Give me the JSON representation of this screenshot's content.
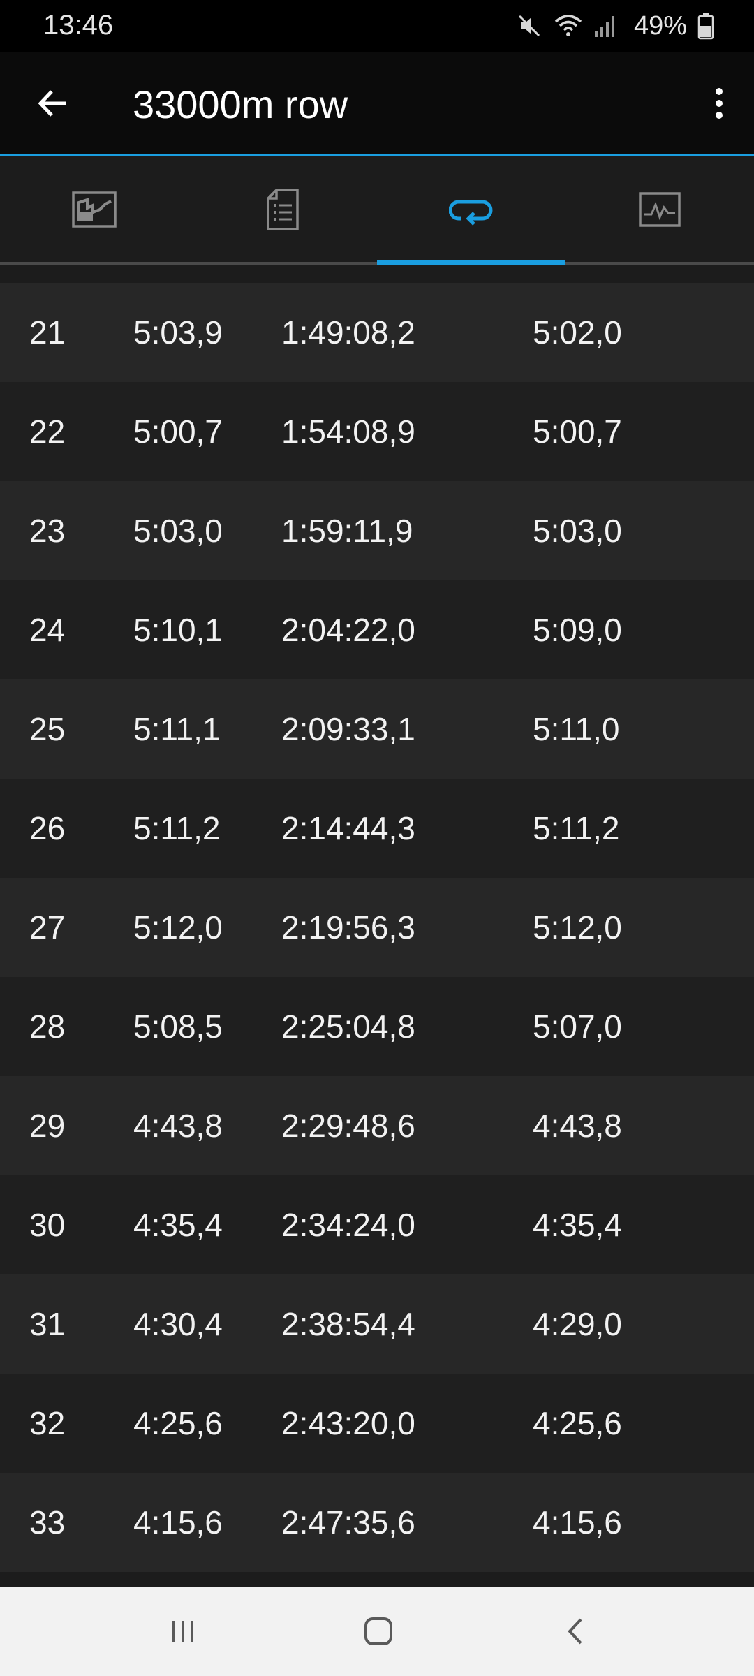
{
  "status_bar": {
    "time": "13:46",
    "battery": "49%",
    "icons": [
      "mute-icon",
      "wifi-icon",
      "signal-icon",
      "battery-icon"
    ]
  },
  "app_bar": {
    "title": "33000m row",
    "back_icon": "arrow-left-icon",
    "menu_icon": "more-vert-icon"
  },
  "tabs": [
    {
      "name": "summary-map-icon",
      "active": false
    },
    {
      "name": "details-list-icon",
      "active": false
    },
    {
      "name": "laps-loop-icon",
      "active": true
    },
    {
      "name": "graph-icon",
      "active": false
    }
  ],
  "colors": {
    "accent": "#1a9ee0",
    "row_odd": "#272727",
    "row_even": "#1f1f1f",
    "nav_bar": "#f2f2f2"
  },
  "laps": [
    {
      "lap": "21",
      "time": "5:03,9",
      "cumulative": "1:49:08,2",
      "pace": "5:02,0"
    },
    {
      "lap": "22",
      "time": "5:00,7",
      "cumulative": "1:54:08,9",
      "pace": "5:00,7"
    },
    {
      "lap": "23",
      "time": "5:03,0",
      "cumulative": "1:59:11,9",
      "pace": "5:03,0"
    },
    {
      "lap": "24",
      "time": "5:10,1",
      "cumulative": "2:04:22,0",
      "pace": "5:09,0"
    },
    {
      "lap": "25",
      "time": "5:11,1",
      "cumulative": "2:09:33,1",
      "pace": "5:11,0"
    },
    {
      "lap": "26",
      "time": "5:11,2",
      "cumulative": "2:14:44,3",
      "pace": "5:11,2"
    },
    {
      "lap": "27",
      "time": "5:12,0",
      "cumulative": "2:19:56,3",
      "pace": "5:12,0"
    },
    {
      "lap": "28",
      "time": "5:08,5",
      "cumulative": "2:25:04,8",
      "pace": "5:07,0"
    },
    {
      "lap": "29",
      "time": "4:43,8",
      "cumulative": "2:29:48,6",
      "pace": "4:43,8"
    },
    {
      "lap": "30",
      "time": "4:35,4",
      "cumulative": "2:34:24,0",
      "pace": "4:35,4"
    },
    {
      "lap": "31",
      "time": "4:30,4",
      "cumulative": "2:38:54,4",
      "pace": "4:29,0"
    },
    {
      "lap": "32",
      "time": "4:25,6",
      "cumulative": "2:43:20,0",
      "pace": "4:25,6"
    },
    {
      "lap": "33",
      "time": "4:15,6",
      "cumulative": "2:47:35,6",
      "pace": "4:15,6"
    }
  ],
  "nav_bar": {
    "icons": [
      "recent-apps-icon",
      "home-icon",
      "back-icon"
    ]
  }
}
